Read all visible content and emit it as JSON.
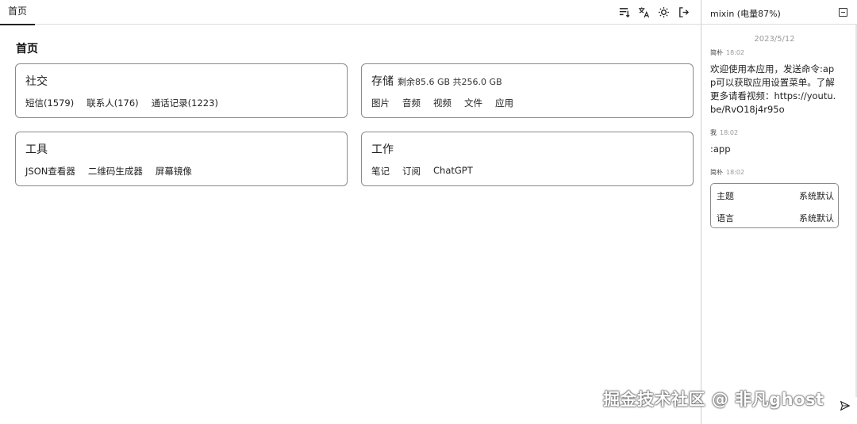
{
  "topbar": {
    "tab_home": "首页",
    "icons": [
      "sort-icon",
      "translate-icon",
      "brightness-icon",
      "logout-icon"
    ]
  },
  "main": {
    "title": "首页",
    "cards": [
      {
        "title": "社交",
        "subtitle": "",
        "links": [
          "短信(1579)",
          "联系人(176)",
          "通话记录(1223)"
        ]
      },
      {
        "title": "存储",
        "subtitle": "剩余85.6 GB 共256.0 GB",
        "links": [
          "图片",
          "音频",
          "视频",
          "文件",
          "应用"
        ]
      },
      {
        "title": "工具",
        "subtitle": "",
        "links": [
          "JSON查看器",
          "二维码生成器",
          "屏幕镜像"
        ]
      },
      {
        "title": "工作",
        "subtitle": "",
        "links": [
          "笔记",
          "订阅",
          "ChatGPT"
        ]
      }
    ]
  },
  "panel": {
    "title": "mixin (电量87%)",
    "date": "2023/5/12",
    "messages": [
      {
        "sender": "简朴",
        "time": "18:02",
        "text": "欢迎使用本应用，发送命令:app可以获取应用设置菜单。了解更多请看视频：https://youtu.be/RvO18j4r95o"
      },
      {
        "sender": "我",
        "time": "18:02",
        "text": ":app"
      },
      {
        "sender": "简朴",
        "time": "18:02",
        "text": ""
      }
    ],
    "settings": [
      {
        "label": "主题",
        "value": "系统默认"
      },
      {
        "label": "语言",
        "value": "系统默认"
      }
    ]
  },
  "watermark": "掘金技术社区 @ 非凡ghost",
  "colors": {
    "border": "#8a8a8a",
    "text": "#222222",
    "muted": "#999999"
  }
}
